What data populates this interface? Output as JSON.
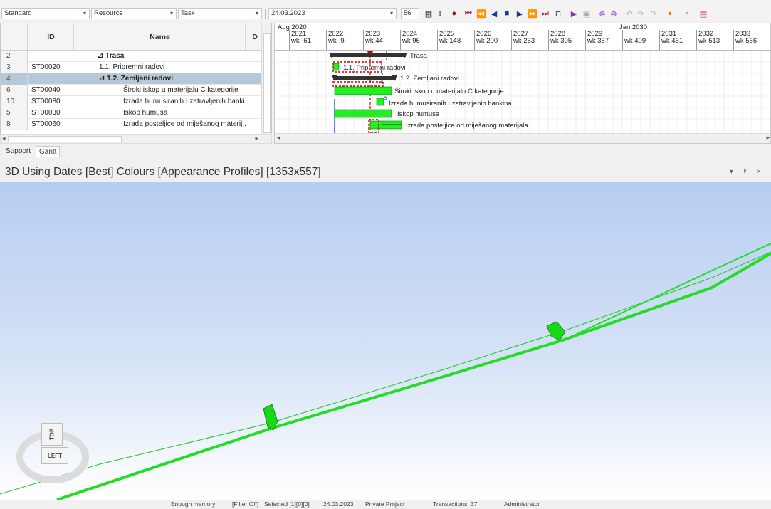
{
  "toolbar": {
    "combo_standard": "Standard",
    "combo_resource": "Resource",
    "combo_task": "Task",
    "date_value": "24.03.2023",
    "zoom_value": "56"
  },
  "grid": {
    "headers": {
      "id": "ID",
      "name": "Name",
      "d": "D"
    },
    "rows": [
      {
        "num": "2",
        "id": "",
        "name": "⊿ Trasa",
        "bold": true,
        "indent": 0
      },
      {
        "num": "3",
        "id": "ST00020",
        "name": "1.1. Pripremni radovi",
        "bold": false,
        "indent": 1
      },
      {
        "num": "4",
        "id": "",
        "name": "⊿ 1.2. Zemljani radovi",
        "bold": true,
        "indent": 1
      },
      {
        "num": "6",
        "id": "ST00040",
        "name": "Široki iskop u materijalu C kategorije",
        "bold": false,
        "indent": 2
      },
      {
        "num": "10",
        "id": "ST00080",
        "name": "Izrada humusiranih I zatravljenih banki...",
        "bold": false,
        "indent": 2
      },
      {
        "num": "5",
        "id": "ST00030",
        "name": "Iskop humusa",
        "bold": false,
        "indent": 2
      },
      {
        "num": "8",
        "id": "ST00060",
        "name": "Izrada posteljice od miješanog materij...",
        "bold": false,
        "indent": 2
      }
    ]
  },
  "gantt": {
    "top_left_label": "Aug 2020",
    "top_right_label": "Jan 2030",
    "years": [
      "2021",
      "2022",
      "2023",
      "2024",
      "2025",
      "2026",
      "2027",
      "2028",
      "2029",
      "",
      "2031",
      "2032",
      "2033",
      "20"
    ],
    "weeks": [
      "wk -61",
      "wk -9",
      "wk 44",
      "wk 96",
      "wk 148",
      "wk 200",
      "wk 253",
      "wk 305",
      "wk 357",
      "wk 409",
      "wk 461",
      "wk 513",
      "wk 566",
      "w"
    ],
    "bar_labels": [
      "Trasa",
      "1.1. Pripremni radovi",
      "1.2. Zemljani radovi",
      "Široki iskop u materijalu C kategorije",
      "Izrada humusiranih I zatravljenih bankina",
      "Iskop humusa",
      "Izrada posteljice od miješanog materijala"
    ]
  },
  "tabs": [
    "Support",
    "Gantt"
  ],
  "viewport": {
    "title": "3D Using Dates [Best] Colours [Appearance Profiles]  [1353x557]",
    "controls": "▾ ᵖ ×",
    "cube_top": "TOP",
    "cube_left": "LEFT"
  },
  "status": {
    "memory": "Enough memory",
    "filter": "[Filter Off]",
    "selected": "Selected [1][0][0]",
    "date": "24.03.2023",
    "project": "Private Project",
    "transactions": "Transactions: 37",
    "user": "Administrator"
  },
  "colors": {
    "bar_green": "#22ee22",
    "summary_bar": "#333333",
    "progress_red": "#cc0000",
    "baseline_blue": "#1f5fd6",
    "selected_row": "#b7c9d6",
    "sky_top": "#b6cdf2"
  }
}
